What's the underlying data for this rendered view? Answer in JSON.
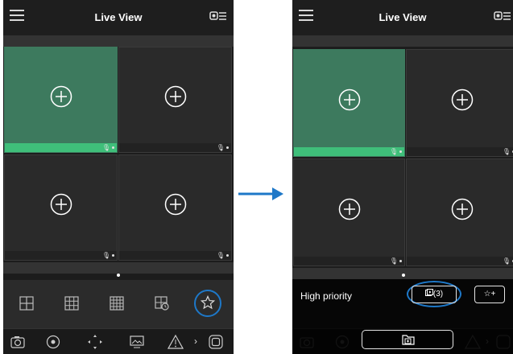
{
  "left_screen": {
    "title": "Live View",
    "bottom_chevron": "›"
  },
  "right_screen": {
    "title": "Live View",
    "panel": {
      "label": "High priority",
      "preset_button": "(3)",
      "add_button": "☆+"
    }
  },
  "colors": {
    "accent_ring": "#1e78c8",
    "selected_cell": "#3d7a5e",
    "selected_footer": "#3fbf7a"
  },
  "icons": [
    "menu-icon",
    "record-list-icon",
    "add-camera-icon",
    "mic-icon",
    "layout-1-icon",
    "layout-4-icon",
    "layout-9-icon",
    "playback-icon",
    "favorites-star-icon",
    "snapshot-icon",
    "record-icon",
    "ptz-icon",
    "image-adjust-icon",
    "alarm-icon",
    "fullscreen-icon",
    "folder-add-icon",
    "arrow-right-icon"
  ]
}
